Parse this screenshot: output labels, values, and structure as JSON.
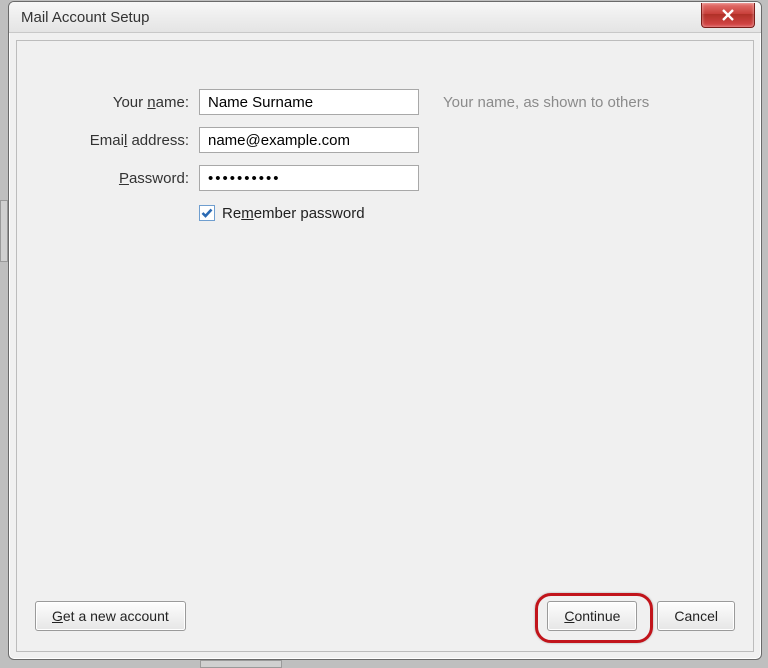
{
  "window": {
    "title": "Mail Account Setup"
  },
  "form": {
    "name": {
      "label_pre": "Your ",
      "label_ak": "n",
      "label_post": "ame:",
      "value": "Name Surname",
      "hint": "Your name, as shown to others"
    },
    "email": {
      "label_pre": "Emai",
      "label_ak": "l",
      "label_post": " address:",
      "value": "name@example.com"
    },
    "password": {
      "label_ak": "P",
      "label_post": "assword:",
      "value": "••••••••••"
    },
    "remember": {
      "checked": true,
      "label_pre": "Re",
      "label_ak": "m",
      "label_post": "ember password"
    }
  },
  "buttons": {
    "new_account": {
      "ak": "G",
      "post": "et a new account"
    },
    "continue": {
      "ak": "C",
      "post": "ontinue"
    },
    "cancel": {
      "text": "Cancel"
    }
  }
}
